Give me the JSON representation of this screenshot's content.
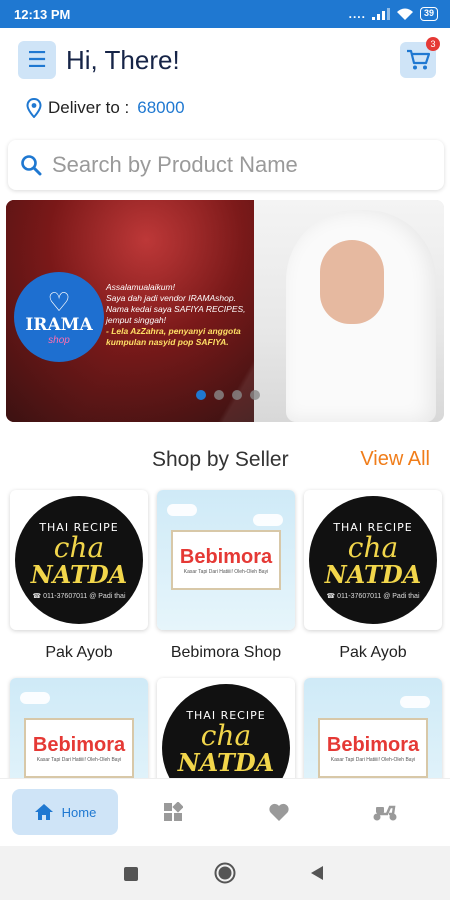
{
  "status_bar": {
    "time": "12:13 PM",
    "signal_dots": "....",
    "battery": "39"
  },
  "header": {
    "greeting": "Hi, There!",
    "cart_count": "3"
  },
  "deliver": {
    "label": "Deliver to :",
    "postcode": "68000"
  },
  "search": {
    "placeholder": "Search by Product Name"
  },
  "banner": {
    "logo_text": "IRAMA",
    "logo_sub": "shop",
    "message_lines": [
      "Assalamualaikum!",
      "Saya dah jadi vendor IRAMAshop.",
      "Nama kedai saya SAFIYA RECIPES,",
      "jemput singgah!",
      "- Lela AzZahra, penyanyi anggota",
      "kumpulan nasyid pop SAFIYA."
    ],
    "highlight_name": "SAFIYA RECIPES"
  },
  "section": {
    "title": "Shop by Seller",
    "view_all": "View All"
  },
  "sellers": [
    {
      "name": "Pak Ayob",
      "logo": "natda"
    },
    {
      "name": "Bebimora Shop",
      "logo": "bebimora"
    },
    {
      "name": "Pak Ayob",
      "logo": "natda"
    },
    {
      "name": "",
      "logo": "bebimora"
    },
    {
      "name": "",
      "logo": "natda"
    },
    {
      "name": "",
      "logo": "bebimora"
    }
  ],
  "logo_text": {
    "natda_top": "THAI RECIPE",
    "natda_cha": "cha",
    "natda_name": "NATDA",
    "natda_small": "☎ 011-37607011  @ Padi thai",
    "bebimora_name": "Bebimora",
    "bebimora_tag": "Kasar Tapi Dari Hatiiii! Oleh-Oleh Bayi"
  },
  "bottom_nav": {
    "home_label": "Home"
  },
  "colors": {
    "primary": "#1f78d1",
    "accent": "#f07d1a",
    "badge": "#e53935",
    "nav_active_bg": "#cfe4f7"
  },
  "icons": [
    "menu-icon",
    "cart-icon",
    "location-pin-icon",
    "search-icon",
    "home-icon",
    "grid-icon",
    "heart-icon",
    "scooter-icon",
    "android-square-icon",
    "android-circle-icon",
    "android-back-icon"
  ]
}
